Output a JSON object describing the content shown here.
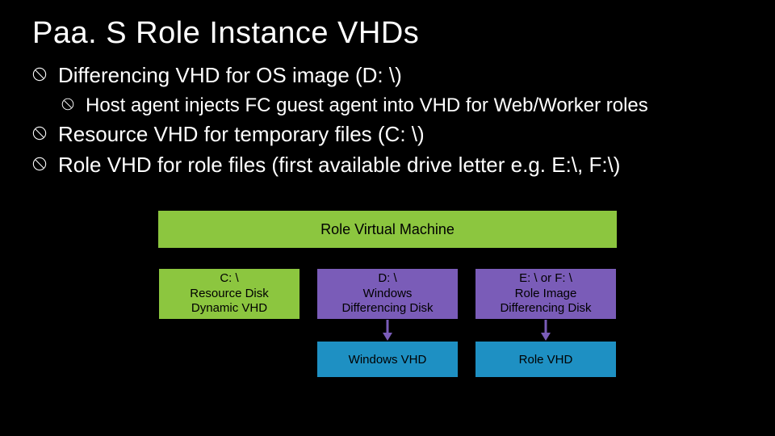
{
  "title": "Paa. S Role Instance VHDs",
  "bullets": {
    "b1": "Differencing VHD for OS image (D: \\)",
    "b1a": "Host agent injects FC guest agent into VHD for Web/Worker roles",
    "b2": "Resource VHD for temporary files (C: \\)",
    "b3": "Role VHD for role files (first available drive letter e.g. E:\\, F:\\)"
  },
  "diagram": {
    "vm_label": "Role Virtual Machine",
    "disk_c_l1": "C: \\",
    "disk_c_l2": "Resource Disk",
    "disk_c_l3": "Dynamic VHD",
    "disk_d_l1": "D: \\",
    "disk_d_l2": "Windows",
    "disk_d_l3": "Differencing Disk",
    "disk_e_l1": "E: \\ or F: \\",
    "disk_e_l2": "Role Image",
    "disk_e_l3": "Differencing Disk",
    "vhd_windows": "Windows VHD",
    "vhd_role": "Role VHD"
  }
}
